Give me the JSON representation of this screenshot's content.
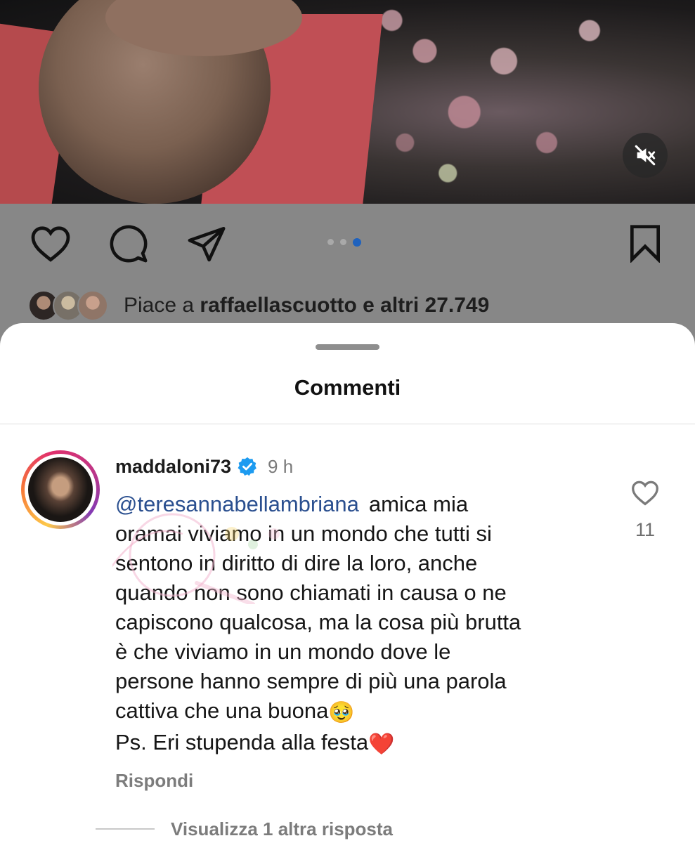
{
  "post": {
    "likes_prefix": "Piace a ",
    "likes_user": "raffaellascuotto",
    "likes_suffix": " e altri 27.749",
    "carousel_pages": 3,
    "carousel_active": 3
  },
  "icons": {
    "like": "heart-icon",
    "comment": "comment-bubble-icon",
    "share": "send-icon",
    "save": "bookmark-icon",
    "mute": "speaker-muted-icon",
    "verified": "verified-badge-icon",
    "comment_like": "heart-icon"
  },
  "sheet": {
    "title": "Commenti"
  },
  "comment": {
    "username": "maddaloni73",
    "time": "9 h",
    "mention": "@teresannabellambriana",
    "lines": [
      "amica mia",
      "oramai viviamo in un mondo che tutti si",
      "sentono in diritto di dire la loro, anche",
      "quando non sono chiamati in causa o ne",
      "capiscono qualcosa, ma la cosa più brutta",
      "è che viviamo in un mondo dove le",
      "persone hanno sempre di più una parola",
      "cattiva che una buona",
      "Ps. Eri stupenda alla festa"
    ],
    "emoji_1": "🥹",
    "emoji_2": "❤️",
    "like_count": "11",
    "reply_label": "Rispondi",
    "more_replies": "Visualizza 1 altra risposta"
  },
  "colors": {
    "verified": "#1d9bf0",
    "mention": "#2a4f8f",
    "overlay": "#878787",
    "active_dot": "#1f62bd"
  }
}
